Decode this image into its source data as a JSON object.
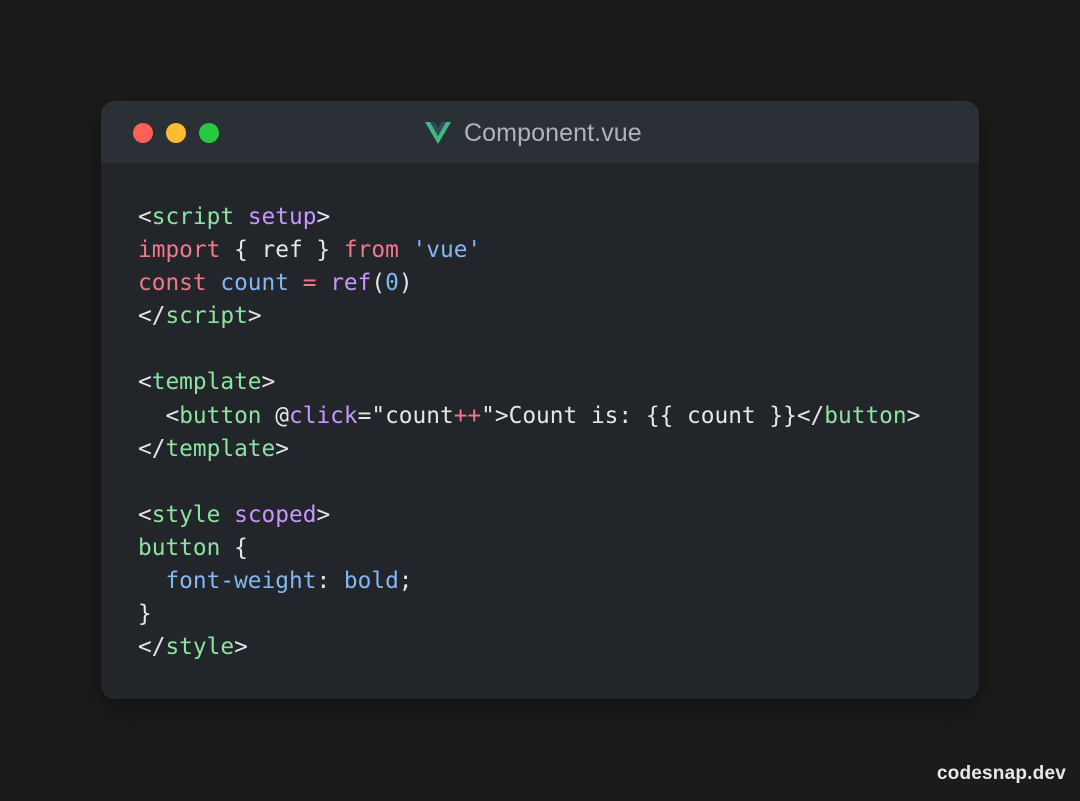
{
  "window": {
    "title": "Component.vue",
    "file_icon": "vue-logo-icon",
    "controls": [
      "close",
      "minimize",
      "maximize"
    ]
  },
  "colors": {
    "tag": "#8ee2a0",
    "keyword": "#f27788",
    "attribute": "#c796ff",
    "variable": "#84b6f3",
    "plain": "#e6e6e6",
    "number": "#84b6f3"
  },
  "code_lines": [
    [
      [
        "<",
        "plain"
      ],
      [
        "script",
        "tag"
      ],
      [
        " ",
        "plain"
      ],
      [
        "setup",
        "attribute"
      ],
      [
        ">",
        "plain"
      ]
    ],
    [
      [
        "import",
        "keyword"
      ],
      [
        " { ref } ",
        "plain"
      ],
      [
        "from",
        "keyword"
      ],
      [
        " ",
        "plain"
      ],
      [
        "'vue'",
        "variable"
      ]
    ],
    [
      [
        "const",
        "keyword"
      ],
      [
        " ",
        "plain"
      ],
      [
        "count",
        "variable"
      ],
      [
        " ",
        "plain"
      ],
      [
        "=",
        "keyword"
      ],
      [
        " ",
        "plain"
      ],
      [
        "ref",
        "attribute"
      ],
      [
        "(",
        "plain"
      ],
      [
        "0",
        "number"
      ],
      [
        ")",
        "plain"
      ]
    ],
    [
      [
        "</",
        "plain"
      ],
      [
        "script",
        "tag"
      ],
      [
        ">",
        "plain"
      ]
    ],
    [],
    [
      [
        "<",
        "plain"
      ],
      [
        "template",
        "tag"
      ],
      [
        ">",
        "plain"
      ]
    ],
    [
      [
        "  <",
        "plain"
      ],
      [
        "button",
        "tag"
      ],
      [
        " @",
        "plain"
      ],
      [
        "click",
        "attribute"
      ],
      [
        "=\"count",
        "plain"
      ],
      [
        "++",
        "keyword"
      ],
      [
        "\">Count is: {{ count }}</",
        "plain"
      ],
      [
        "button",
        "tag"
      ],
      [
        ">",
        "plain"
      ]
    ],
    [
      [
        "</",
        "plain"
      ],
      [
        "template",
        "tag"
      ],
      [
        ">",
        "plain"
      ]
    ],
    [],
    [
      [
        "<",
        "plain"
      ],
      [
        "style",
        "tag"
      ],
      [
        " ",
        "plain"
      ],
      [
        "scoped",
        "attribute"
      ],
      [
        ">",
        "plain"
      ]
    ],
    [
      [
        "button",
        "tag"
      ],
      [
        " {",
        "plain"
      ]
    ],
    [
      [
        "  ",
        "plain"
      ],
      [
        "font-weight",
        "variable"
      ],
      [
        ": ",
        "plain"
      ],
      [
        "bold",
        "variable"
      ],
      [
        ";",
        "plain"
      ]
    ],
    [
      [
        "}",
        "plain"
      ]
    ],
    [
      [
        "</",
        "plain"
      ],
      [
        "style",
        "tag"
      ],
      [
        ">",
        "plain"
      ]
    ]
  ],
  "watermark": "codesnap.dev"
}
